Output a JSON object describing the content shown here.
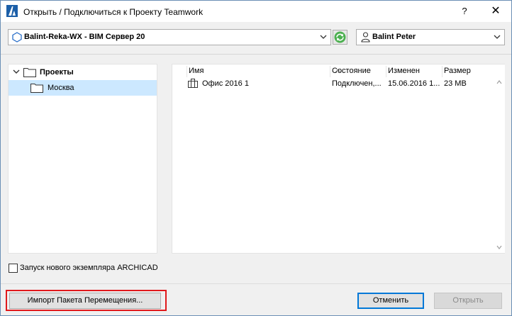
{
  "window": {
    "title": "Открыть / Подключиться к Проекту Teamwork",
    "help_label": "?",
    "close_label": "✕"
  },
  "server": {
    "selected": "Balint-Reka-WX - BIM Сервер 20"
  },
  "user": {
    "selected": "Balint Peter"
  },
  "tree": {
    "root": "Проекты",
    "child": "Москва"
  },
  "list": {
    "columns": [
      "Имя",
      "Состояние",
      "Изменен",
      "Размер"
    ],
    "rows": [
      {
        "name": "Офис 2016 1",
        "status": "Подключен,...",
        "modified": "15.06.2016 1...",
        "size": "23 MB"
      }
    ]
  },
  "options": {
    "new_instance_label": "Запуск нового экземпляра ARCHICAD",
    "new_instance_checked": false
  },
  "buttons": {
    "import_label": "Импорт Пакета Перемещения...",
    "cancel_label": "Отменить",
    "open_label": "Открыть"
  },
  "colors": {
    "accent": "#0078d7",
    "selection": "#cce8ff",
    "highlight": "#e0191c",
    "refresh_green": "#2e9e35"
  }
}
